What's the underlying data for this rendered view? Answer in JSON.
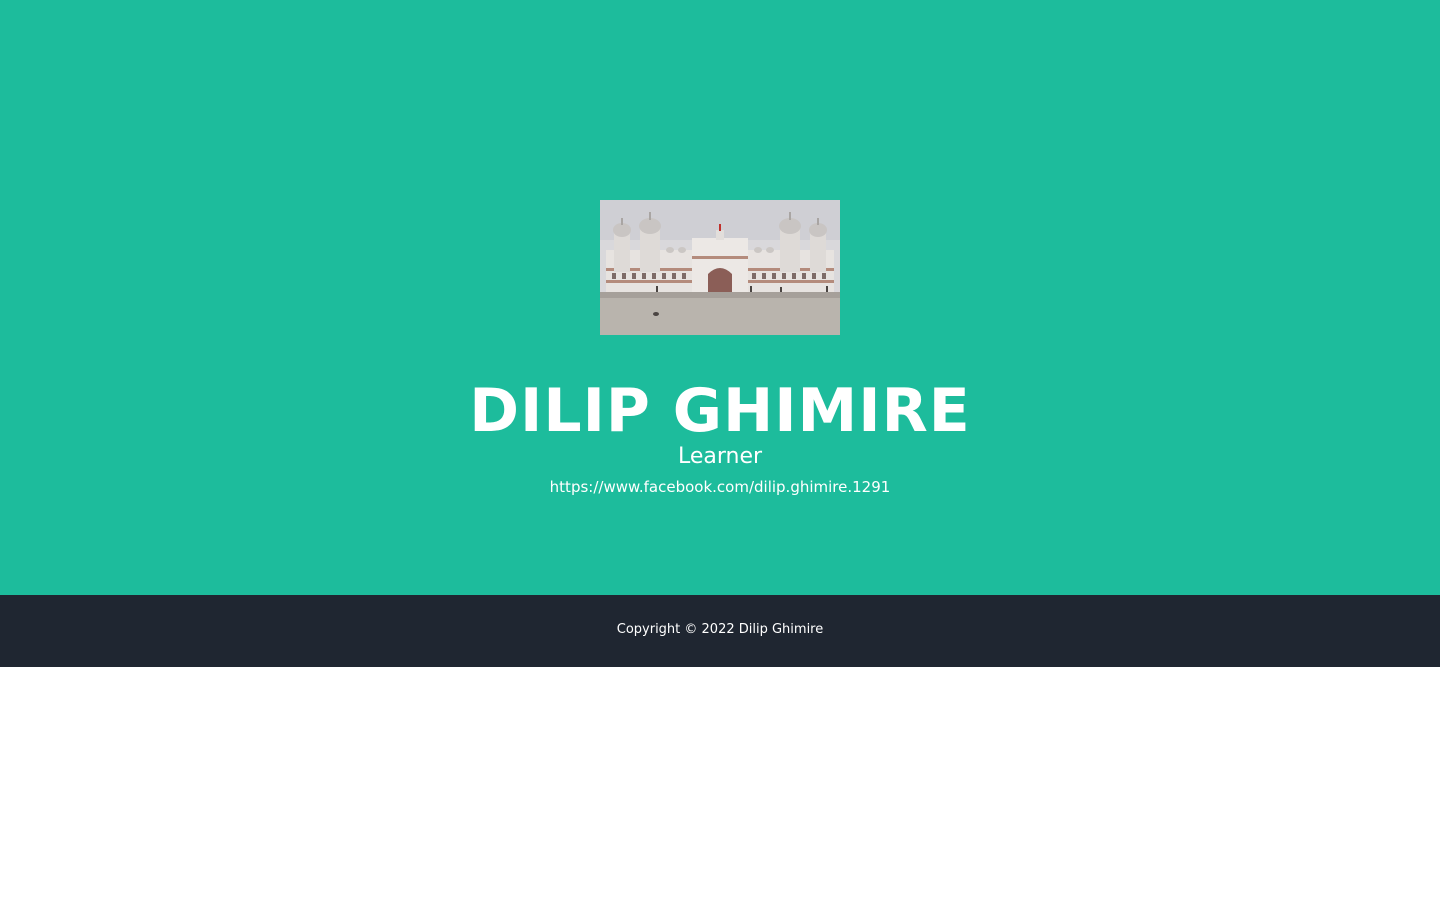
{
  "profile": {
    "image_alt": "Janaki Mandir palace photo",
    "name": "DILIP GHIMIRE",
    "tagline": "Learner",
    "link": "https://www.facebook.com/dilip.ghimire.1291"
  },
  "footer": {
    "copyright": "Copyright © 2022 Dilip Ghimire"
  },
  "colors": {
    "masthead_bg": "#1dbc9c",
    "footer_bg": "#1f2631",
    "text": "#ffffff"
  }
}
